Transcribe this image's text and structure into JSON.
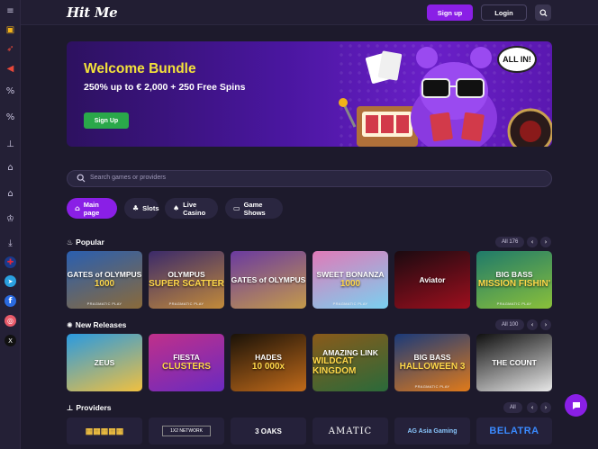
{
  "header": {
    "logo": "Hit Me",
    "signup_label": "Sign up",
    "login_label": "Login"
  },
  "sidebar": {
    "items": [
      {
        "icon": "menu-icon",
        "glyph": "≡"
      },
      {
        "icon": "gift-icon",
        "glyph": "▣"
      },
      {
        "icon": "rocket-icon",
        "glyph": "➶"
      },
      {
        "icon": "megaphone-icon",
        "glyph": "◀"
      },
      {
        "icon": "percent-icon",
        "glyph": "%"
      },
      {
        "icon": "percent-icon",
        "glyph": "%"
      },
      {
        "icon": "trophy-stand-icon",
        "glyph": "⊥"
      },
      {
        "icon": "building-icon",
        "glyph": "⌂"
      },
      {
        "icon": "bank-icon",
        "glyph": "⌂"
      },
      {
        "icon": "trophy-icon",
        "glyph": "♔"
      },
      {
        "icon": "download-icon",
        "glyph": "⤓"
      },
      {
        "icon": "uk-flag-icon",
        "glyph": "✚"
      },
      {
        "icon": "telegram-icon",
        "glyph": "➤"
      },
      {
        "icon": "facebook-icon",
        "glyph": "f"
      },
      {
        "icon": "instagram-icon",
        "glyph": "◎"
      },
      {
        "icon": "x-twitter-icon",
        "glyph": "X"
      }
    ]
  },
  "banner": {
    "title": "Welcome Bundle",
    "subtitle": "250% up to € 2,000 + 250 Free Spins",
    "button_label": "Sign Up",
    "bubble_text": "ALL IN!"
  },
  "search": {
    "placeholder": "Search games or providers"
  },
  "tabs": [
    {
      "label": "Main page",
      "icon": "home-icon",
      "glyph": "⌂",
      "active": true
    },
    {
      "label": "Slots",
      "icon": "slots-icon",
      "glyph": "♣",
      "active": false
    },
    {
      "label": "Live Casino",
      "icon": "live-casino-icon",
      "glyph": "♠",
      "active": false
    },
    {
      "label": "Game Shows",
      "icon": "game-shows-icon",
      "glyph": "▭",
      "active": false
    }
  ],
  "popular": {
    "title": "Popular",
    "icon": "fire-icon",
    "all_label": "All",
    "count": "176",
    "games": [
      {
        "line1": "GATES of OLYMPUS",
        "line2": "1000",
        "provider": "PRAGMATIC PLAY",
        "color1": "#2a5fb0",
        "color2": "#8a6a3a"
      },
      {
        "line1": "OLYMPUS",
        "line2": "SUPER SCATTER",
        "provider": "PRAGMATIC PLAY",
        "color1": "#3b2a6a",
        "color2": "#c28a3a"
      },
      {
        "line1": "GATES of OLYMPUS",
        "line2": "",
        "provider": "",
        "color1": "#6a3aa0",
        "color2": "#c49a4a"
      },
      {
        "line1": "SWEET BONANZA",
        "line2": "1000",
        "provider": "PRAGMATIC PLAY",
        "color1": "#e07ab8",
        "color2": "#7ad0f0"
      },
      {
        "line1": "Aviator",
        "line2": "",
        "provider": "",
        "color1": "#1a0a10",
        "color2": "#9e0f1e"
      },
      {
        "line1": "BIG BASS",
        "line2": "MISSION FISHIN'",
        "provider": "PRAGMATIC PLAY",
        "color1": "#1f7a6a",
        "color2": "#8ac03a"
      }
    ]
  },
  "new_releases": {
    "title": "New Releases",
    "icon": "sparkle-icon",
    "all_label": "All",
    "count": "100",
    "games": [
      {
        "line1": "ZEUS",
        "line2": "",
        "provider": "",
        "color1": "#2a9ae0",
        "color2": "#f0c040"
      },
      {
        "line1": "FIESTA",
        "line2": "CLUSTERS",
        "provider": "",
        "color1": "#c0308a",
        "color2": "#6a2ac0"
      },
      {
        "line1": "HADES",
        "line2": "10 000x",
        "provider": "",
        "color1": "#1a1208",
        "color2": "#c06a1a"
      },
      {
        "line1": "AMAZING LINK",
        "line2": "WILDCAT KINGDOM",
        "provider": "",
        "color1": "#8a5a1a",
        "color2": "#2a6a3a"
      },
      {
        "line1": "BIG BASS",
        "line2": "HALLOWEEN 3",
        "provider": "PRAGMATIC PLAY",
        "color1": "#1a3a7a",
        "color2": "#e07a1a"
      },
      {
        "line1": "THE COUNT",
        "line2": "",
        "provider": "",
        "color1": "#101010",
        "color2": "#e8e8e8"
      }
    ]
  },
  "providers": {
    "title": "Providers",
    "icon": "provider-icon",
    "all_label": "All",
    "items": [
      {
        "label": "▦▦▦▦▦"
      },
      {
        "label": "1X2 NETWORK"
      },
      {
        "label": "3 OAKS"
      },
      {
        "label": "AMATIC"
      },
      {
        "label": "AG Asia Gaming"
      },
      {
        "label": "BELATRA"
      }
    ]
  }
}
